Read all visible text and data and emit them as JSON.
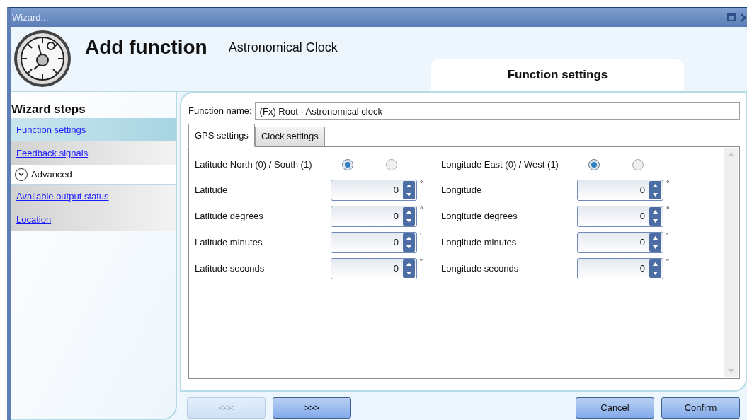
{
  "window": {
    "title": "Wizard..."
  },
  "header": {
    "title": "Add function",
    "subtitle": "Astronomical Clock",
    "page_tab": "Function settings"
  },
  "sidebar": {
    "heading": "Wizard steps",
    "items": [
      {
        "kind": "link",
        "label": "Function settings",
        "selected": true
      },
      {
        "kind": "link",
        "label": "Feedback signals",
        "selected": false
      },
      {
        "kind": "group",
        "label": "Advanced",
        "expanded": true,
        "children": [
          {
            "kind": "link",
            "label": "Available output status",
            "selected": false
          },
          {
            "kind": "link",
            "label": "Location",
            "selected": false
          }
        ]
      }
    ]
  },
  "function_name": {
    "label": "Function name:",
    "value": "(Fx) Root - Astronomical clock"
  },
  "tabs": [
    {
      "label": "GPS settings",
      "selected": true
    },
    {
      "label": "Clock settings",
      "selected": false
    }
  ],
  "rows": [
    {
      "kind": "radio",
      "left": {
        "label": "Latitude North (0) / South (1)",
        "options": [
          {
            "selected": true
          },
          {
            "selected": false
          }
        ]
      },
      "right": {
        "label": "Longitude East (0) / West (1)",
        "options": [
          {
            "selected": true
          },
          {
            "selected": false
          }
        ]
      }
    },
    {
      "kind": "spinner",
      "left": {
        "label": "Latitude",
        "value": "0",
        "unit": "°"
      },
      "right": {
        "label": "Longitude",
        "value": "0",
        "unit": "°"
      }
    },
    {
      "kind": "spinner",
      "left": {
        "label": "Latitude degrees",
        "value": "0",
        "unit": "°"
      },
      "right": {
        "label": "Longitude degrees",
        "value": "0",
        "unit": "°"
      }
    },
    {
      "kind": "spinner",
      "left": {
        "label": "Latitude minutes",
        "value": "0",
        "unit": "'"
      },
      "right": {
        "label": "Longitude minutes",
        "value": "0",
        "unit": "'"
      }
    },
    {
      "kind": "spinner",
      "left": {
        "label": "Latitude seconds",
        "value": "0",
        "unit": "\""
      },
      "right": {
        "label": "Longitude seconds",
        "value": "0",
        "unit": "\""
      }
    }
  ],
  "nav_buttons": [
    {
      "label": "<<<",
      "disabled": true
    },
    {
      "label": ">>>",
      "disabled": false
    }
  ],
  "action_buttons": [
    {
      "label": "Cancel"
    },
    {
      "label": "Confirm"
    }
  ]
}
